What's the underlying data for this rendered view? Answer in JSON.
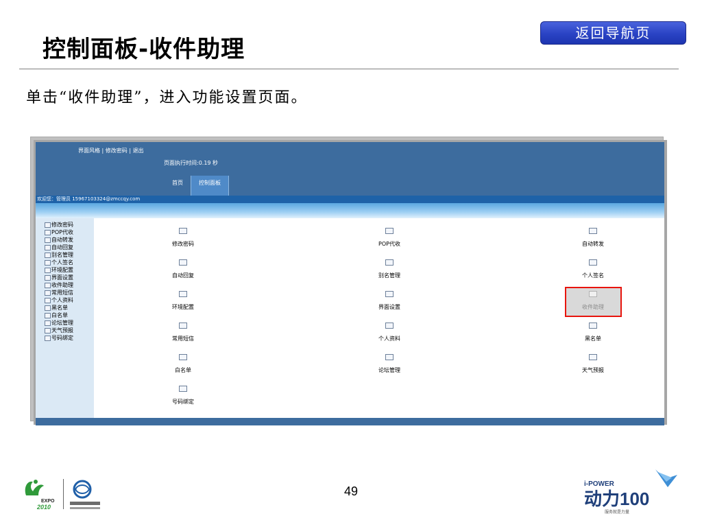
{
  "slide": {
    "title": "控制面板-收件助理",
    "nav_button": "返回导航页",
    "instruction": "单击“收件助理”，进入功能设置页面。",
    "page_number": "49"
  },
  "app": {
    "header_links": {
      "theme": "界面风格",
      "sep1": " | ",
      "change_password": "修改密码",
      "sep2": " | ",
      "logout": "退出"
    },
    "exec_time": "页面执行时间:0.19 秒",
    "tabs": [
      {
        "label": "首页"
      },
      {
        "label": "控制面板"
      }
    ],
    "welcome": "欢迎您：管理员 15967103324@zmccqy.com",
    "sidebar": [
      {
        "label": "修改密码"
      },
      {
        "label": "POP代收"
      },
      {
        "label": "自动转发"
      },
      {
        "label": "自动回复"
      },
      {
        "label": "别名管理"
      },
      {
        "label": "个人签名"
      },
      {
        "label": "环境配置"
      },
      {
        "label": "界面设置"
      },
      {
        "label": "收件助理"
      },
      {
        "label": "常用短信"
      },
      {
        "label": "个人资料"
      },
      {
        "label": "黑名单"
      },
      {
        "label": "白名单"
      },
      {
        "label": "论坛管理"
      },
      {
        "label": "天气预报"
      },
      {
        "label": "号码绑定"
      }
    ],
    "grid": [
      {
        "label": "修改密码",
        "icon": "key-icon"
      },
      {
        "label": "POP代收",
        "icon": "mailbox-icon"
      },
      {
        "label": "自动转发",
        "icon": "forward-icon"
      },
      {
        "label": "自动回复",
        "icon": "reply-icon"
      },
      {
        "label": "别名管理",
        "icon": "alias-icon"
      },
      {
        "label": "个人签名",
        "icon": "signature-icon"
      },
      {
        "label": "环境配置",
        "icon": "settings-icon"
      },
      {
        "label": "界面设置",
        "icon": "theme-icon"
      },
      {
        "label": "收件助理",
        "icon": "inbox-assistant-icon"
      },
      {
        "label": "常用短信",
        "icon": "sms-icon"
      },
      {
        "label": "个人资料",
        "icon": "profile-icon"
      },
      {
        "label": "黑名单",
        "icon": "blacklist-icon"
      },
      {
        "label": "白名单",
        "icon": "whitelist-icon"
      },
      {
        "label": "论坛管理",
        "icon": "forum-icon"
      },
      {
        "label": "天气预报",
        "icon": "weather-icon"
      },
      {
        "label": "号码绑定",
        "icon": "phone-binding-icon"
      }
    ],
    "highlighted_item": "收件助理"
  },
  "logos": {
    "expo_text": "EXPO",
    "expo_year": "2010",
    "power_top": "i-POWER",
    "power_main": "动力100",
    "power_sub": "服务就是力量"
  },
  "colors": {
    "header_blue": "#3d6c9e",
    "welcome_blue": "#1e62a8",
    "sidebar_bg": "#dbe9f5",
    "highlight_red": "#e8140d",
    "nav_button_blue": "#2a43c4"
  }
}
